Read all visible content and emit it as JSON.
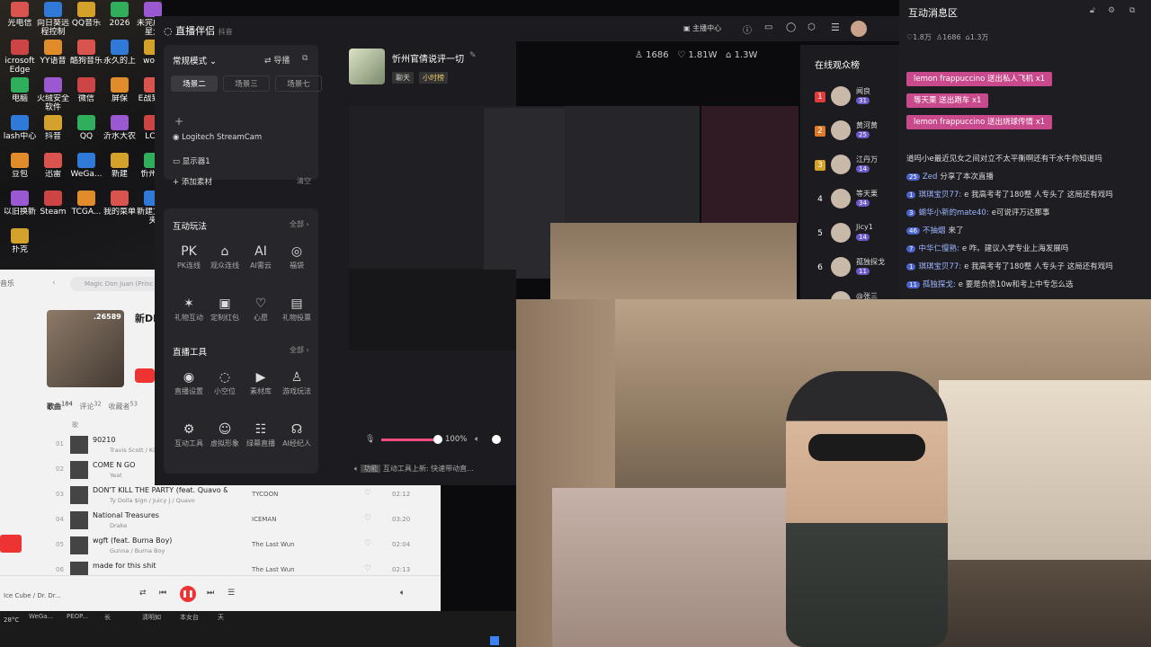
{
  "desktop": {
    "icons": [
      {
        "label": "光电信"
      },
      {
        "label": "向日葵远程控制"
      },
      {
        "label": "QQ音乐"
      },
      {
        "label": "2026"
      },
      {
        "label": "未完成明星大"
      },
      {
        "label": "icrosoft Edge"
      },
      {
        "label": "YY语音"
      },
      {
        "label": "酷狗音乐"
      },
      {
        "label": "永久的上"
      },
      {
        "label": "work"
      },
      {
        "label": "电脑"
      },
      {
        "label": "火绒安全软件"
      },
      {
        "label": "微信"
      },
      {
        "label": "屏保"
      },
      {
        "label": "E战到底"
      },
      {
        "label": "lash中心"
      },
      {
        "label": "抖音"
      },
      {
        "label": "QQ"
      },
      {
        "label": "沂水大农"
      },
      {
        "label": "LCR"
      },
      {
        "label": "豆包"
      },
      {
        "label": "迅雷"
      },
      {
        "label": "WeGa..."
      },
      {
        "label": "新建"
      },
      {
        "label": "忻州旧"
      },
      {
        "label": "以旧换新"
      },
      {
        "label": "Steam"
      },
      {
        "label": "TCGA..."
      },
      {
        "label": "我的菜单"
      },
      {
        "label": "新建文件夹"
      },
      {
        "label": "扑克"
      }
    ]
  },
  "music": {
    "sidebar_label": "音乐",
    "search_placeholder": "Magic Don Juan (Princ",
    "album_count": ".26589",
    "section": "新Dl",
    "tabs": {
      "songs": "歌曲",
      "songs_count": "184",
      "comments": "评论",
      "comments_count": "32",
      "favorites": "收藏者",
      "favorites_count": "53"
    },
    "col_title": "歌",
    "tracks": [
      {
        "num": "01",
        "title": "90210",
        "artist": "Travis Scott / Kid Cudi",
        "album": "",
        "duration": ""
      },
      {
        "num": "02",
        "title": "COME N GO",
        "artist": "Yeat",
        "album": "",
        "duration": ""
      },
      {
        "num": "03",
        "title": "DON'T KILL THE PARTY (feat. Quavo & I...",
        "artist": "Ty Dolla $ign / Juicy J / Quavo",
        "album": "TYCOON",
        "duration": "02:12"
      },
      {
        "num": "04",
        "title": "National Treasures",
        "artist": "Drake",
        "album": "ICEMAN",
        "duration": "03:20"
      },
      {
        "num": "05",
        "title": "wgft (feat. Burna Boy)",
        "artist": "Gunna / Burna Boy",
        "album": "The Last Wun",
        "duration": "02:04"
      },
      {
        "num": "06",
        "title": "made for this shit",
        "artist": "",
        "album": "The Last Wun",
        "duration": "02:13"
      }
    ],
    "now_playing": "Ice Cube / Dr. Dr..."
  },
  "taskbar": {
    "temp": "28°C",
    "items": [
      "WeGa...",
      "PEOP...",
      "长",
      "清明如",
      "本女台",
      "天"
    ]
  },
  "companion": {
    "app_title": "直播伴侣",
    "app_sub": "抖音",
    "mode": "常规模式",
    "guide": "导播",
    "scenes": [
      "场景二",
      "场景三",
      "场景七"
    ],
    "sources": [
      "Logitech StreamCam",
      "显示器1"
    ],
    "add_source": "添加素材",
    "clear": "清空",
    "interactive_title": "互动玩法",
    "all": "全部",
    "interactive": [
      {
        "icon": "PK",
        "label": "PK连线"
      },
      {
        "icon": "⌂",
        "label": "观众连线"
      },
      {
        "icon": "AI",
        "label": "AI需云"
      },
      {
        "icon": "◎",
        "label": "福袋"
      },
      {
        "icon": "✶",
        "label": "礼物互动"
      },
      {
        "icon": "▣",
        "label": "定制红包"
      },
      {
        "icon": "♡",
        "label": "心愿"
      },
      {
        "icon": "▤",
        "label": "礼物投票"
      }
    ],
    "tools_title": "直播工具",
    "tools": [
      {
        "icon": "◉",
        "label": "直播设置"
      },
      {
        "icon": "◌",
        "label": "小空位"
      },
      {
        "icon": "▶",
        "label": "素材库"
      },
      {
        "icon": "♙",
        "label": "游戏玩法"
      },
      {
        "icon": "⚙",
        "label": "互动工具"
      },
      {
        "icon": "☺",
        "label": "虚拟形象"
      },
      {
        "icon": "☷",
        "label": "绿幕直播"
      },
      {
        "icon": "☊",
        "label": "AI经纪人"
      }
    ],
    "volume": "100%",
    "notice_tag": "功能",
    "notice": "互动工具上新: 快速带动直..."
  },
  "stream": {
    "title": "忻州官倩说评一切",
    "tag1": "聊天",
    "tag2": "小时榜",
    "viewers": "1686",
    "likes": "1.81W",
    "gifts": "1.3W",
    "toolbar": [
      "主播中心"
    ]
  },
  "viewers_panel": {
    "title": "在线观众榜",
    "list": [
      {
        "rank": "1",
        "name": "闻良",
        "level": "31"
      },
      {
        "rank": "2",
        "name": "黄河黄",
        "level": "25"
      },
      {
        "rank": "3",
        "name": "江丹万",
        "level": "14"
      },
      {
        "rank": "4",
        "name": "等天栗",
        "level": "34"
      },
      {
        "rank": "5",
        "name": "Jicy1",
        "level": "14"
      },
      {
        "rank": "6",
        "name": "孤独探戈",
        "level": "11"
      },
      {
        "rank": "",
        "name": "@张三",
        "level": ""
      }
    ]
  },
  "chat": {
    "title": "互动消息区",
    "stats": [
      "1.8万",
      "1686",
      "1.3万"
    ],
    "gifts": [
      {
        "user": "lemon frappuccino",
        "action": "送出私人飞机",
        "count": "x1"
      },
      {
        "user": "等天栗",
        "action": "送出跑车",
        "count": "x1"
      },
      {
        "user": "lemon frappuccino",
        "action": "送出烧球传情",
        "count": "x1"
      }
    ],
    "messages": [
      {
        "badge": "",
        "user": "",
        "text": "道吗小e最近见女之间对立不太平衡啊还有干水牛你知道吗"
      },
      {
        "badge": "25",
        "user": "Zed",
        "text": "分享了本次直播"
      },
      {
        "badge": "1",
        "user": "琪琪宝贝77:",
        "text": "e 我高考考了180整 人专头了 这局还有戏吗"
      },
      {
        "badge": "3",
        "user": "蝴华小新的mate40:",
        "text": "e可说评万达那事"
      },
      {
        "badge": "46",
        "user": "不抽烟",
        "text": "来了"
      },
      {
        "badge": "7",
        "user": "中华仁慢熟:",
        "text": "e 咋。建议入学专业上海发展吗"
      },
      {
        "badge": "1",
        "user": "琪琪宝贝77:",
        "text": "e 我高考考了180整 人专头子 这局还有戏吗"
      },
      {
        "badge": "11",
        "user": "孤独探戈:",
        "text": "e 要是负债10w和考上中专怎么选"
      }
    ]
  }
}
